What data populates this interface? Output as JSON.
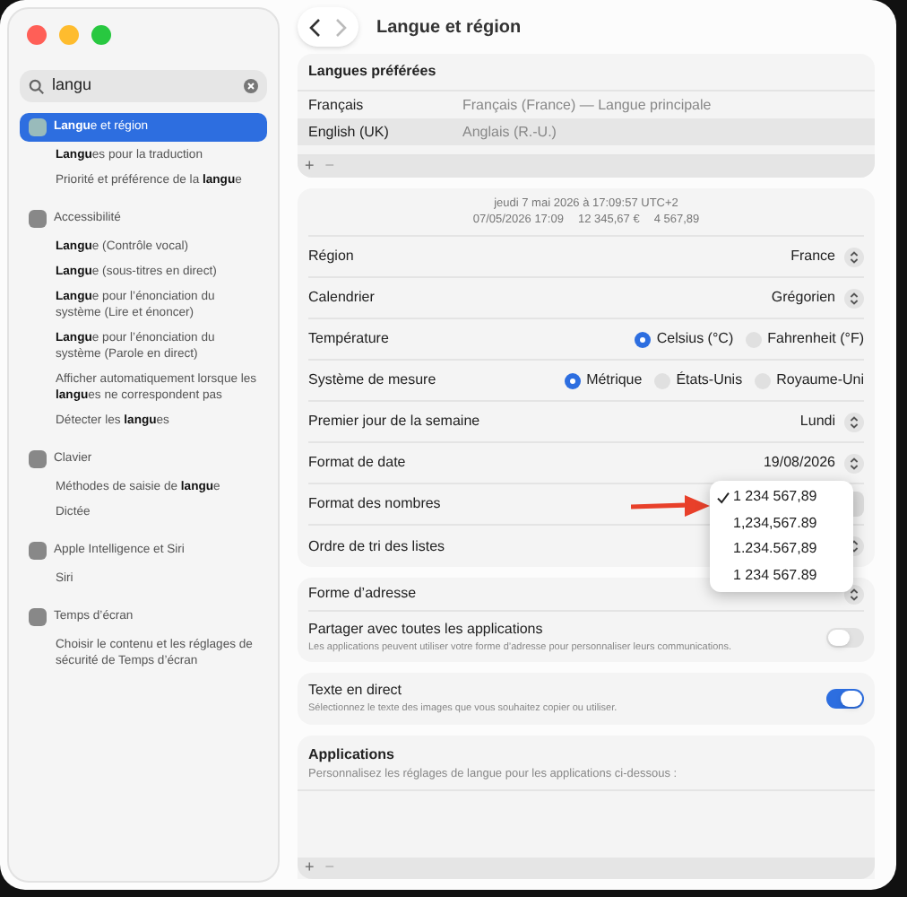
{
  "sidebar": {
    "search": {
      "value": "langu"
    },
    "results": [
      {
        "kind": "section",
        "text": "**Langu**e et région",
        "selected": true
      },
      {
        "kind": "result",
        "text": "**Langu**es pour la traduction",
        "selected": false
      },
      {
        "kind": "result",
        "text": "Priorité et préférence de la **langu**e",
        "selected": false
      },
      {
        "kind": "section",
        "text": "Accessibilité",
        "selected": false
      },
      {
        "kind": "result",
        "text": "**Langu**e (Contrôle vocal)",
        "selected": false
      },
      {
        "kind": "result",
        "text": "**Langu**e (sous-titres en direct)",
        "selected": false
      },
      {
        "kind": "result",
        "text": "**Langu**e pour l’énonciation du système (Lire et énoncer)",
        "selected": false
      },
      {
        "kind": "result",
        "text": "**Langu**e pour l’énonciation du système (Parole en direct)",
        "selected": false
      },
      {
        "kind": "result",
        "text": "Afficher automatiquement lorsque les **langu**es ne correspondent pas",
        "selected": false
      },
      {
        "kind": "result",
        "text": "Détecter les **langu**es",
        "selected": false
      },
      {
        "kind": "section",
        "text": "Clavier",
        "selected": false
      },
      {
        "kind": "result",
        "text": "Méthodes de saisie de **langu**e",
        "selected": false
      },
      {
        "kind": "result",
        "text": "Dictée",
        "selected": false
      },
      {
        "kind": "section",
        "text": "Apple Intelligence et Siri",
        "selected": false
      },
      {
        "kind": "result",
        "text": "Siri",
        "selected": false
      },
      {
        "kind": "section",
        "text": "Temps d’écran",
        "selected": false
      },
      {
        "kind": "result",
        "text": "Choisir le contenu et les réglages de sécurité de Temps d’écran",
        "selected": false
      }
    ]
  },
  "toolbar": {
    "title": "Langue et région"
  },
  "preferred_languages": {
    "title": "Langues préférées",
    "rows": [
      {
        "name": "Français",
        "description": "Français (France) — Langue principale",
        "selected": false
      },
      {
        "name": "English (UK)",
        "description": "Anglais (R.-U.)",
        "selected": true
      }
    ],
    "add": "+",
    "remove": "−"
  },
  "preview": {
    "line_1": "jeudi 7 mai 2026 à 17:09:57 UTC+2",
    "line_2": [
      "07/05/2026 17:09",
      "12 345,67 €",
      "4 567,89"
    ]
  },
  "settings": [
    {
      "kind": "popup",
      "label": "Région",
      "value": "France"
    },
    {
      "kind": "popup",
      "label": "Calendrier",
      "value": "Grégorien"
    },
    {
      "kind": "radio",
      "label": "Température",
      "options": [
        {
          "label": "Celsius (°C)",
          "selected": true
        },
        {
          "label": "Fahrenheit (°F)",
          "selected": false
        }
      ]
    },
    {
      "kind": "radio",
      "label": "Système de mesure",
      "options": [
        {
          "label": "Métrique",
          "selected": true
        },
        {
          "label": "États-Unis",
          "selected": false
        },
        {
          "label": "Royaume-Uni",
          "selected": false
        }
      ]
    },
    {
      "kind": "popup",
      "label": "Premier jour de la semaine",
      "value": "Lundi"
    },
    {
      "kind": "popup",
      "label": "Format de date",
      "value": "19/08/2026"
    },
    {
      "kind": "menu",
      "label": "Format des nombres",
      "options": [
        {
          "label": "1 234 567,89",
          "checked": true
        },
        {
          "label": "1,234,567.89",
          "checked": false
        },
        {
          "label": "1.234.567,89",
          "checked": false
        },
        {
          "label": "1 234 567.89",
          "checked": false
        }
      ]
    },
    {
      "kind": "popup",
      "label": "Ordre de tri des listes"
    }
  ],
  "address": {
    "label": "Forme d’adresse",
    "share_title": "Partager avec toutes les applications",
    "share_description": "Les applications peuvent utiliser votre forme d’adresse pour personnaliser leurs communications.",
    "on": false
  },
  "live_text": {
    "title": "Texte en direct",
    "description": "Sélectionnez le texte des images que vous souhaitez copier ou utiliser.",
    "on": true
  },
  "applications": {
    "title": "Applications",
    "description": "Personnalisez les réglages de langue pour les applications ci-dessous :",
    "add": "+",
    "remove": "−"
  }
}
